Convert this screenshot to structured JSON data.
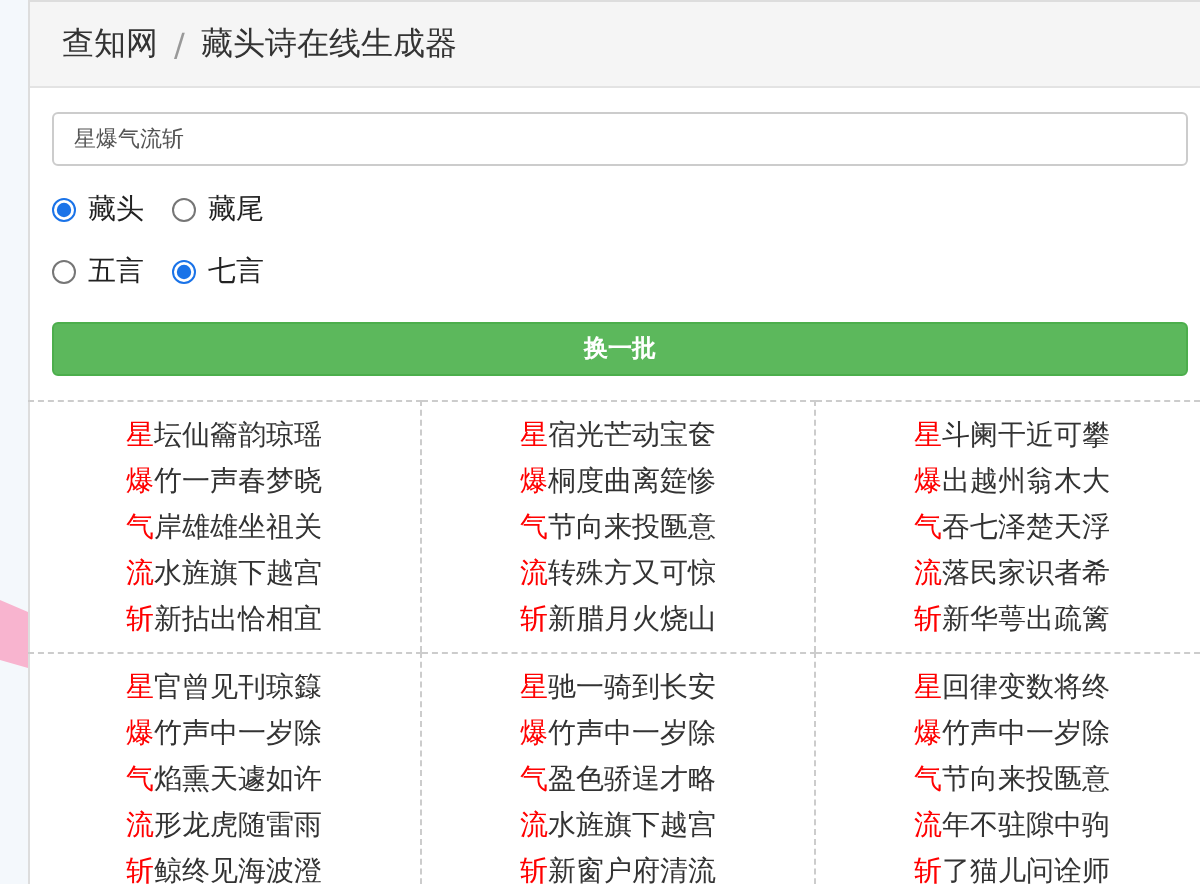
{
  "breadcrumb": {
    "items": [
      "查知网",
      "藏头诗在线生成器"
    ],
    "separator": "/"
  },
  "input": {
    "value": "星爆气流斩"
  },
  "position_options": [
    {
      "label": "藏头",
      "selected": true
    },
    {
      "label": "藏尾",
      "selected": false
    }
  ],
  "length_options": [
    {
      "label": "五言",
      "selected": false
    },
    {
      "label": "七言",
      "selected": true
    }
  ],
  "button": {
    "label": "换一批"
  },
  "poems": [
    {
      "lines": [
        {
          "head": "星",
          "rest": "坛仙籥韵琼瑶"
        },
        {
          "head": "爆",
          "rest": "竹一声春梦晓"
        },
        {
          "head": "气",
          "rest": "岸雄雄坐祖关"
        },
        {
          "head": "流",
          "rest": "水旌旗下越宫"
        },
        {
          "head": "斩",
          "rest": "新拈出恰相宜"
        }
      ]
    },
    {
      "lines": [
        {
          "head": "星",
          "rest": "宿光芒动宝奁"
        },
        {
          "head": "爆",
          "rest": "桐度曲离筵惨"
        },
        {
          "head": "气",
          "rest": "节向来投匦意"
        },
        {
          "head": "流",
          "rest": "转殊方又可惊"
        },
        {
          "head": "斩",
          "rest": "新腊月火烧山"
        }
      ]
    },
    {
      "lines": [
        {
          "head": "星",
          "rest": "斗阑干近可攀"
        },
        {
          "head": "爆",
          "rest": "出越州翁木大"
        },
        {
          "head": "气",
          "rest": "吞七泽楚天浮"
        },
        {
          "head": "流",
          "rest": "落民家识者希"
        },
        {
          "head": "斩",
          "rest": "新华萼出疏篱"
        }
      ]
    },
    {
      "lines": [
        {
          "head": "星",
          "rest": "官曾见刊琼籙"
        },
        {
          "head": "爆",
          "rest": "竹声中一岁除"
        },
        {
          "head": "气",
          "rest": "焰熏天遽如许"
        },
        {
          "head": "流",
          "rest": "形龙虎随雷雨"
        },
        {
          "head": "斩",
          "rest": "鲸终见海波澄"
        }
      ]
    },
    {
      "lines": [
        {
          "head": "星",
          "rest": "驰一骑到长安"
        },
        {
          "head": "爆",
          "rest": "竹声中一岁除"
        },
        {
          "head": "气",
          "rest": "盈色骄逞才略"
        },
        {
          "head": "流",
          "rest": "水旌旗下越宫"
        },
        {
          "head": "斩",
          "rest": "新窗户府清流"
        }
      ]
    },
    {
      "lines": [
        {
          "head": "星",
          "rest": "回律变数将终"
        },
        {
          "head": "爆",
          "rest": "竹声中一岁除"
        },
        {
          "head": "气",
          "rest": "节向来投匦意"
        },
        {
          "head": "流",
          "rest": "年不驻隙中驹"
        },
        {
          "head": "斩",
          "rest": "了猫儿问诠师"
        }
      ]
    }
  ]
}
